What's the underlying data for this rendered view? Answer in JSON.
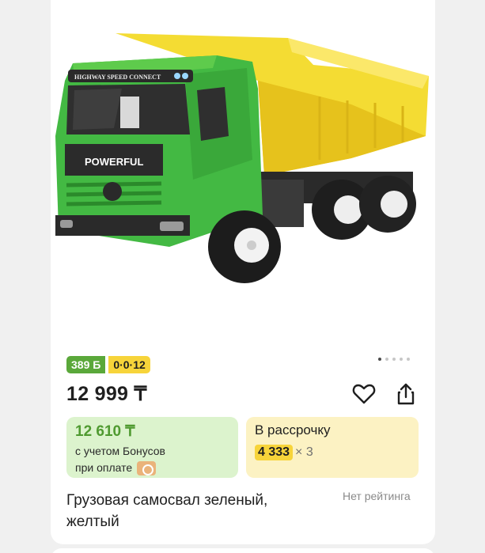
{
  "product": {
    "badges": {
      "bonus": "389 Б",
      "installment": "0·0·12"
    },
    "gallery": {
      "dots": 5,
      "active_dot": 0
    },
    "price": "12 999 ₸",
    "bonus_offer": {
      "price": "12 610 ₸",
      "note_line1": "с учетом Бонусов",
      "note_line2": "при оплате"
    },
    "installment_offer": {
      "title": "В рассрочку",
      "amount": "4 333",
      "times": "× 3"
    },
    "title": "Грузовая самосвал зеленый, желтый",
    "rating": "Нет рейтинга",
    "image_text": {
      "brand": "POWERFUL",
      "cab_text": "HIGHWAY SPEED CONNECT"
    },
    "icons": {
      "favorite": "heart-icon",
      "share": "share-icon",
      "bonus_method": "coin-icon"
    },
    "colors": {
      "bonus_green": "#5aa83a",
      "installment_yellow": "#f7d43a",
      "bonus_box_bg": "#dcf3cd",
      "installment_box_bg": "#fcf2c3"
    }
  }
}
